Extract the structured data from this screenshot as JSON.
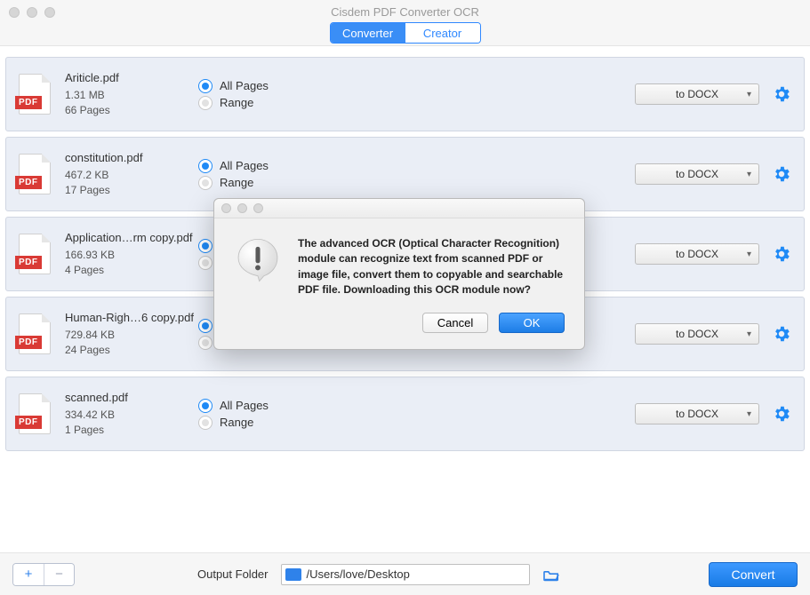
{
  "window": {
    "title": "Cisdem PDF Converter OCR"
  },
  "tabs": {
    "converter": "Converter",
    "creator": "Creator",
    "active": "converter"
  },
  "radio_labels": {
    "all": "All Pages",
    "range": "Range"
  },
  "pdf_badge": "PDF",
  "files": [
    {
      "name": "Ariticle.pdf",
      "size": "1.31 MB",
      "pages": "66 Pages",
      "format": "to DOCX"
    },
    {
      "name": "constitution.pdf",
      "size": "467.2 KB",
      "pages": "17 Pages",
      "format": "to DOCX"
    },
    {
      "name": "Application…rm copy.pdf",
      "size": "166.93 KB",
      "pages": "4 Pages",
      "format": "to DOCX"
    },
    {
      "name": "Human-Righ…6 copy.pdf",
      "size": "729.84 KB",
      "pages": "24 Pages",
      "format": "to DOCX"
    },
    {
      "name": "scanned.pdf",
      "size": "334.42 KB",
      "pages": "1 Pages",
      "format": "to DOCX"
    }
  ],
  "bottom": {
    "add": "+",
    "remove": "−",
    "output_label": "Output Folder",
    "output_path": "/Users/love/Desktop",
    "convert": "Convert"
  },
  "dialog": {
    "message": "The advanced OCR (Optical Character Recognition) module can recognize text from scanned PDF or image file, convert them to copyable and searchable PDF file. Downloading this OCR module now?",
    "cancel": "Cancel",
    "ok": "OK"
  }
}
